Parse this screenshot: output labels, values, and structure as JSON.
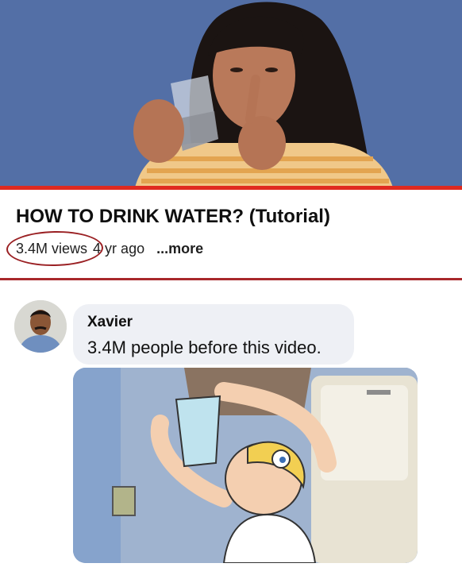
{
  "video": {
    "title": "HOW TO DRINK WATER? (Tutorial)",
    "views": "3.4M views",
    "age": "4 yr ago",
    "more_label": "...more",
    "progress_fraction": 1.0,
    "progress_color": "#e02a20"
  },
  "comment": {
    "author": "Xavier",
    "text": "3.4M people before this video."
  },
  "colors": {
    "divider": "#a8282b",
    "highlight_circle": "#9a2023",
    "bubble_background": "#eef0f5"
  },
  "icons": {
    "thumbnail": "video-thumbnail-image",
    "avatar": "commenter-avatar",
    "comment_image": "comment-attached-image"
  }
}
